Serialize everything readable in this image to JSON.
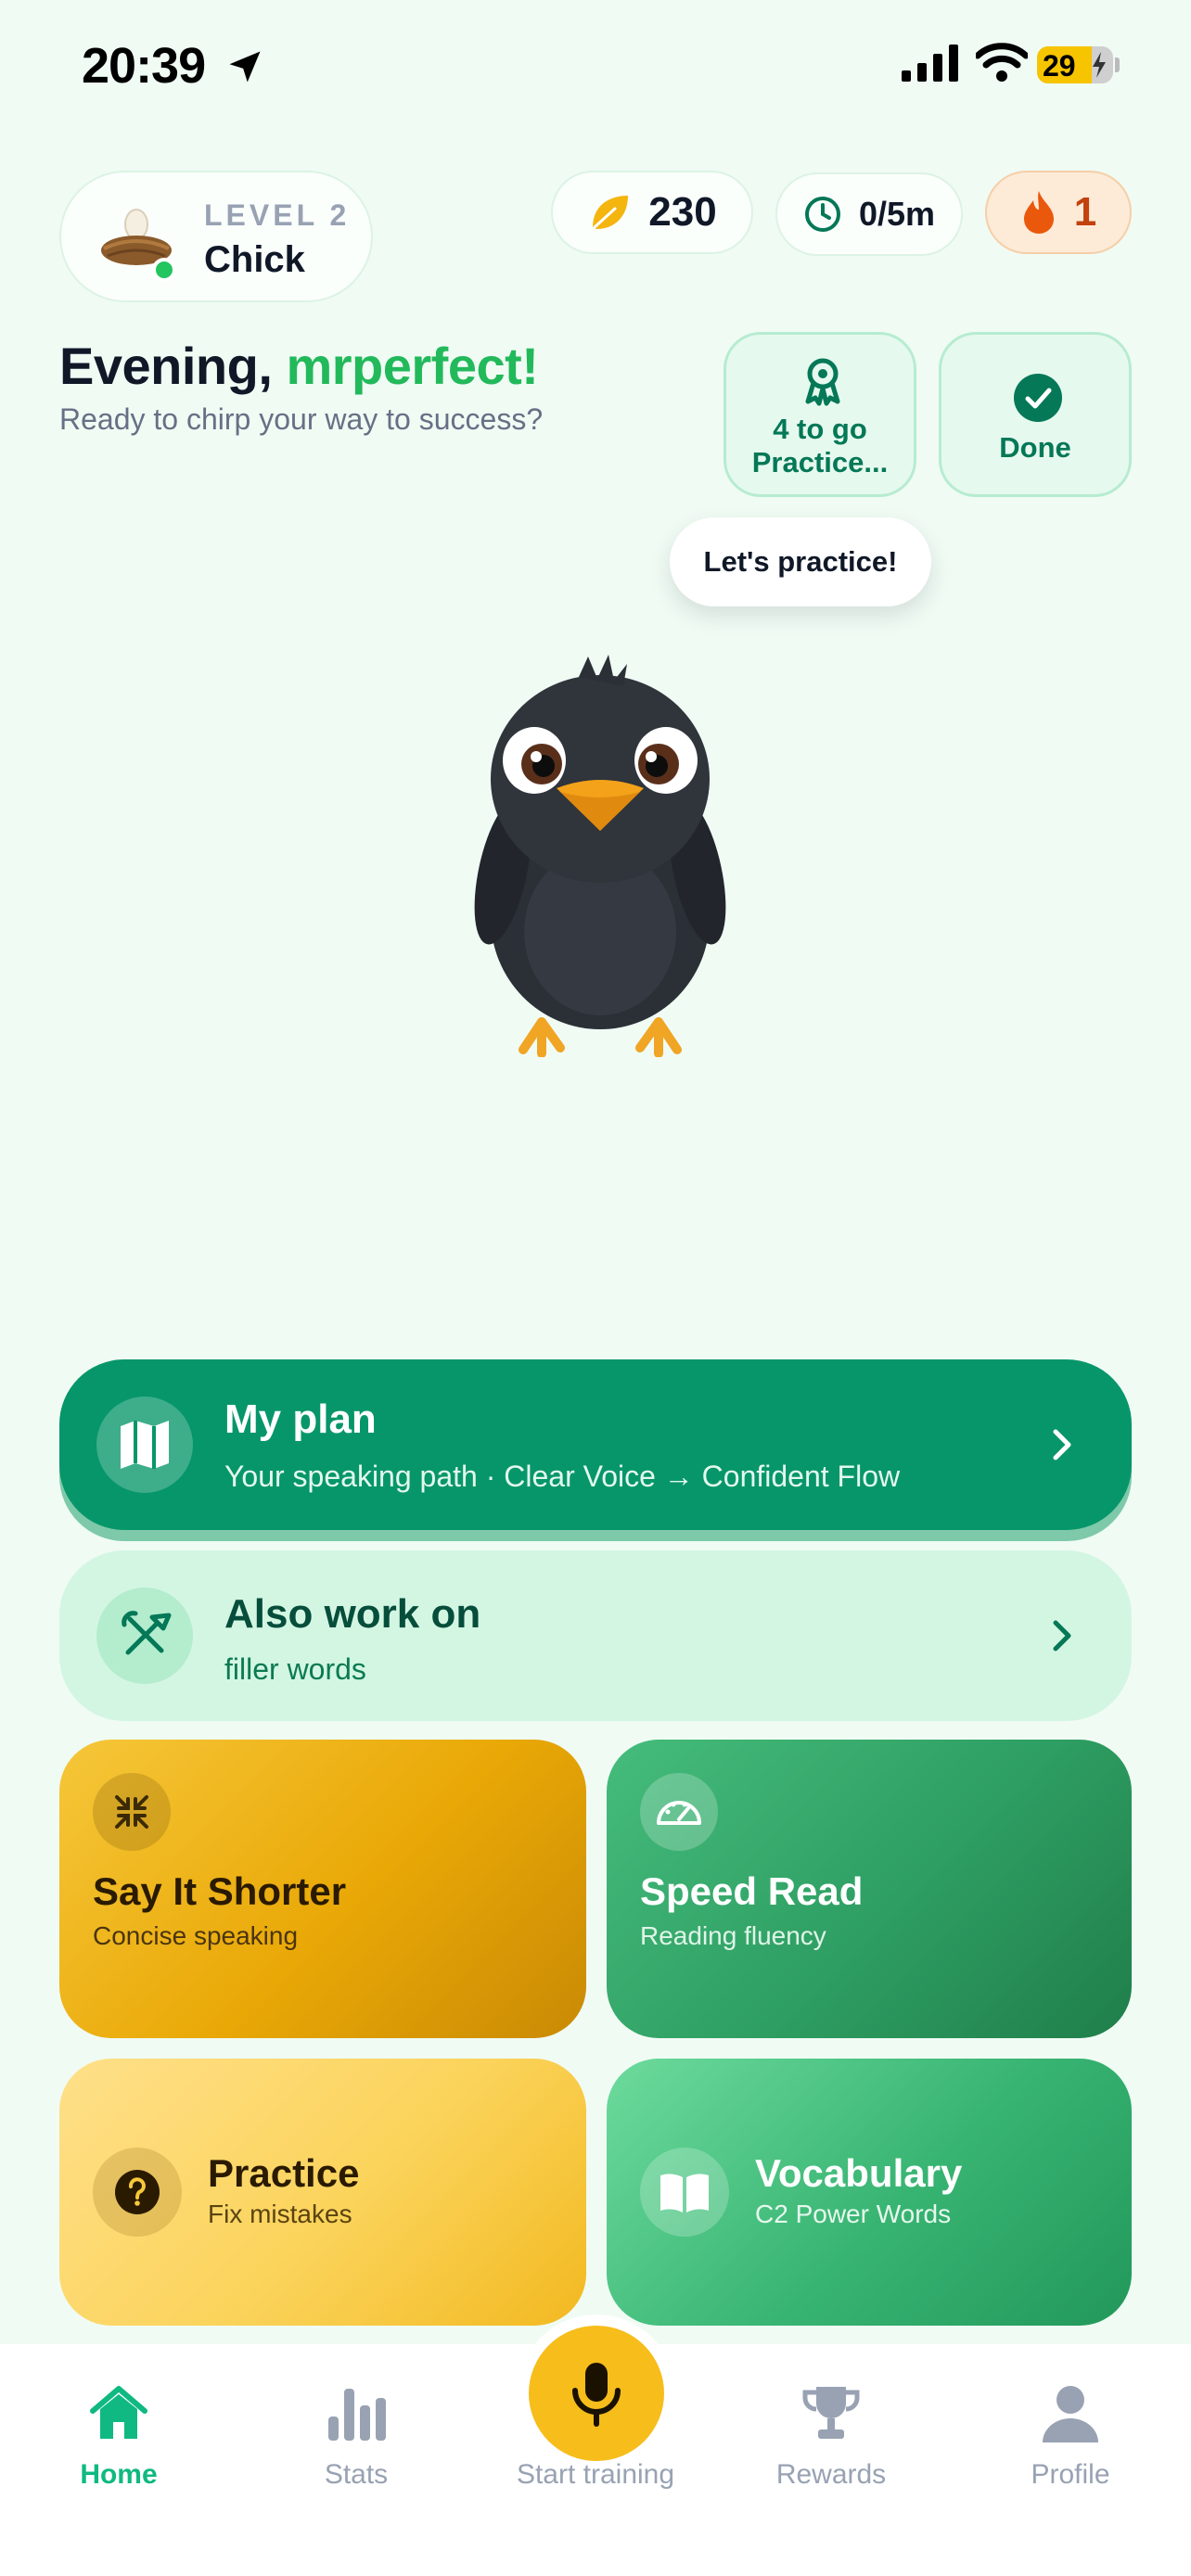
{
  "status_bar": {
    "time": "20:39",
    "battery": "29"
  },
  "header": {
    "level_label": "LEVEL 2",
    "level_name": "Chick",
    "leaves": "230",
    "time_goal": "0/5m",
    "streak": "1"
  },
  "greeting": {
    "prefix": "Evening,",
    "name": "mrperfect!",
    "subtitle": "Ready to chirp your way to success?"
  },
  "goals": {
    "practice_line1": "4 to go",
    "practice_line2": "Practice...",
    "done_label": "Done"
  },
  "mascot": {
    "bubble": "Let's practice!"
  },
  "plan": {
    "title": "My plan",
    "subtitle": "Your speaking path · Clear Voice → Confident Flow"
  },
  "work_on": {
    "title": "Also work on",
    "subtitle": "filler words"
  },
  "tiles": [
    {
      "title": "Say It Shorter",
      "subtitle": "Concise speaking"
    },
    {
      "title": "Speed Read",
      "subtitle": "Reading fluency"
    },
    {
      "title": "Practice",
      "subtitle": "Fix mistakes"
    },
    {
      "title": "Vocabulary",
      "subtitle": "C2 Power Words"
    }
  ],
  "tabbar": {
    "home": "Home",
    "stats": "Stats",
    "start": "Start training",
    "rewards": "Rewards",
    "profile": "Profile"
  },
  "colors": {
    "background": "#f0fbf4",
    "primary_green": "#079669",
    "accent_name": "#22b95b",
    "mic_yellow": "#f7bd1b",
    "streak_orange": "#ea580c"
  },
  "icons": [
    "location-arrow-icon",
    "signal-icon",
    "wifi-icon",
    "battery-icon",
    "nest-egg-icon",
    "leaf-icon",
    "clock-icon",
    "flame-icon",
    "award-icon",
    "check-circle-icon",
    "map-icon",
    "tools-icon",
    "chevron-right-icon",
    "compress-icon",
    "speedometer-icon",
    "question-icon",
    "book-icon",
    "home-icon",
    "stats-icon",
    "mic-icon",
    "trophy-icon",
    "profile-icon"
  ]
}
